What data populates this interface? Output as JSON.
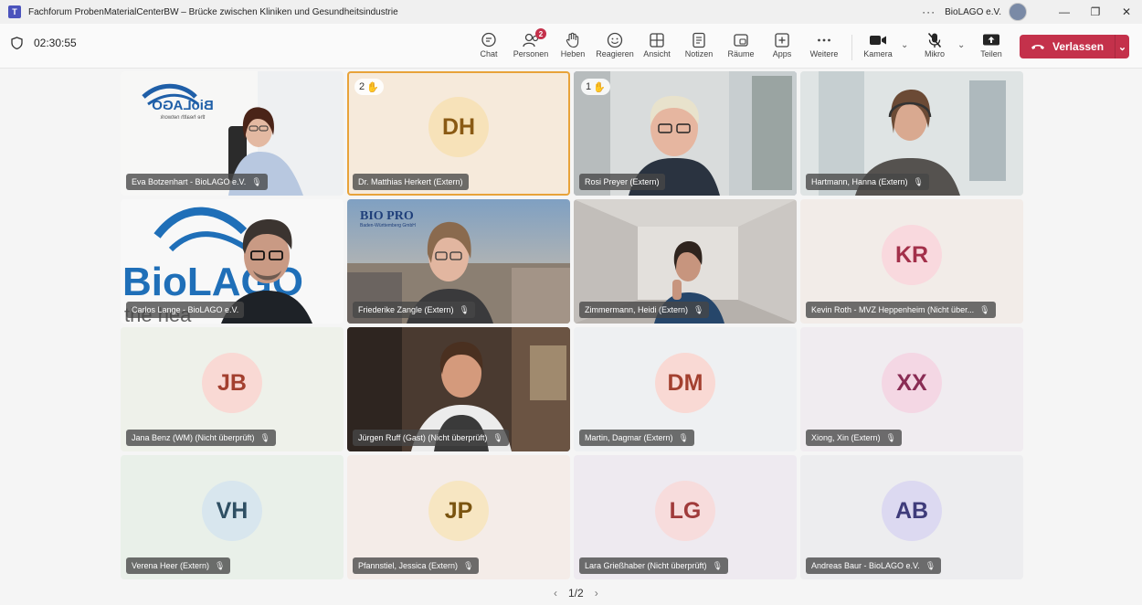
{
  "window": {
    "title": "Fachforum ProbenMaterialCenterBW – Brücke zwischen Kliniken und Gesundheitsindustrie",
    "org": "BioLAGO e.V.",
    "more": "···",
    "minimize": "—",
    "restore": "❐",
    "close": "✕"
  },
  "toolbar": {
    "timer": "02:30:55",
    "chat": "Chat",
    "people": "Personen",
    "people_badge": "2",
    "raise": "Heben",
    "react": "Reagieren",
    "view": "Ansicht",
    "notes": "Notizen",
    "rooms": "Räume",
    "apps": "Apps",
    "more": "Weitere",
    "camera": "Kamera",
    "mic": "Mikro",
    "share": "Teilen",
    "leave": "Verlassen",
    "accent": "#c4314b"
  },
  "participants": [
    {
      "name": "Eva Botzenhart - BioLAGO e.V.",
      "type": "video"
    },
    {
      "name": "Dr. Matthias Herkert (Extern)",
      "initials": "DH",
      "hand": "2",
      "bg": "#f6eadb",
      "avatar_bg": "#f7e2b9",
      "avatar_fg": "#8a5a14"
    },
    {
      "name": "Rosi Preyer (Extern)",
      "type": "video",
      "hand": "1"
    },
    {
      "name": "Hartmann, Hanna (Extern)",
      "type": "video"
    },
    {
      "name": "Carlos Lange - BioLAGO e.V.",
      "type": "video"
    },
    {
      "name": "Friederike Zangle (Extern)",
      "type": "video"
    },
    {
      "name": "Zimmermann, Heidi (Extern)",
      "type": "video"
    },
    {
      "name": "Kevin Roth - MVZ Heppenheim (Nicht über...",
      "initials": "KR",
      "bg": "#f2ece8",
      "avatar_bg": "#f9d9de",
      "avatar_fg": "#a3304a"
    },
    {
      "name": "Jana Benz (WM) (Nicht überprüft)",
      "initials": "JB",
      "bg": "#eef1ea",
      "avatar_bg": "#f9d9d4",
      "avatar_fg": "#a3402f"
    },
    {
      "name": "Jürgen Ruff (Gast) (Nicht überprüft)",
      "type": "video"
    },
    {
      "name": "Martin, Dagmar (Extern)",
      "initials": "DM",
      "bg": "#eef0f2",
      "avatar_bg": "#f9d9d4",
      "avatar_fg": "#a3402f"
    },
    {
      "name": "Xiong, Xin (Extern)",
      "initials": "XX",
      "bg": "#f0ecf0",
      "avatar_bg": "#f4d7e4",
      "avatar_fg": "#8a2d55"
    },
    {
      "name": "Verena Heer (Extern)",
      "initials": "VH",
      "bg": "#e9f0e9",
      "avatar_bg": "#d8e6ee",
      "avatar_fg": "#2f4f63"
    },
    {
      "name": "Pfannstiel, Jessica (Extern)",
      "initials": "JP",
      "bg": "#f4ece8",
      "avatar_bg": "#f7e6c2",
      "avatar_fg": "#7a5410"
    },
    {
      "name": "Lara Grießhaber (Nicht überprüft)",
      "initials": "LG",
      "bg": "#eeeaf0",
      "avatar_bg": "#f7dcdc",
      "avatar_fg": "#a03a3a"
    },
    {
      "name": "Andreas Baur - BioLAGO e.V.",
      "initials": "AB",
      "bg": "#ededef",
      "avatar_bg": "#dcd9f1",
      "avatar_fg": "#3e3b7a"
    }
  ],
  "video_text": {
    "logo1": "BioLAGO",
    "logo1_sub": "the health network",
    "logo2": "BioLAGO",
    "logo2_sub": "the hea",
    "logo3": "BIO PRO",
    "logo3_sub": "Baden-Württemberg GmbH"
  },
  "pager": {
    "label": "1/2"
  }
}
